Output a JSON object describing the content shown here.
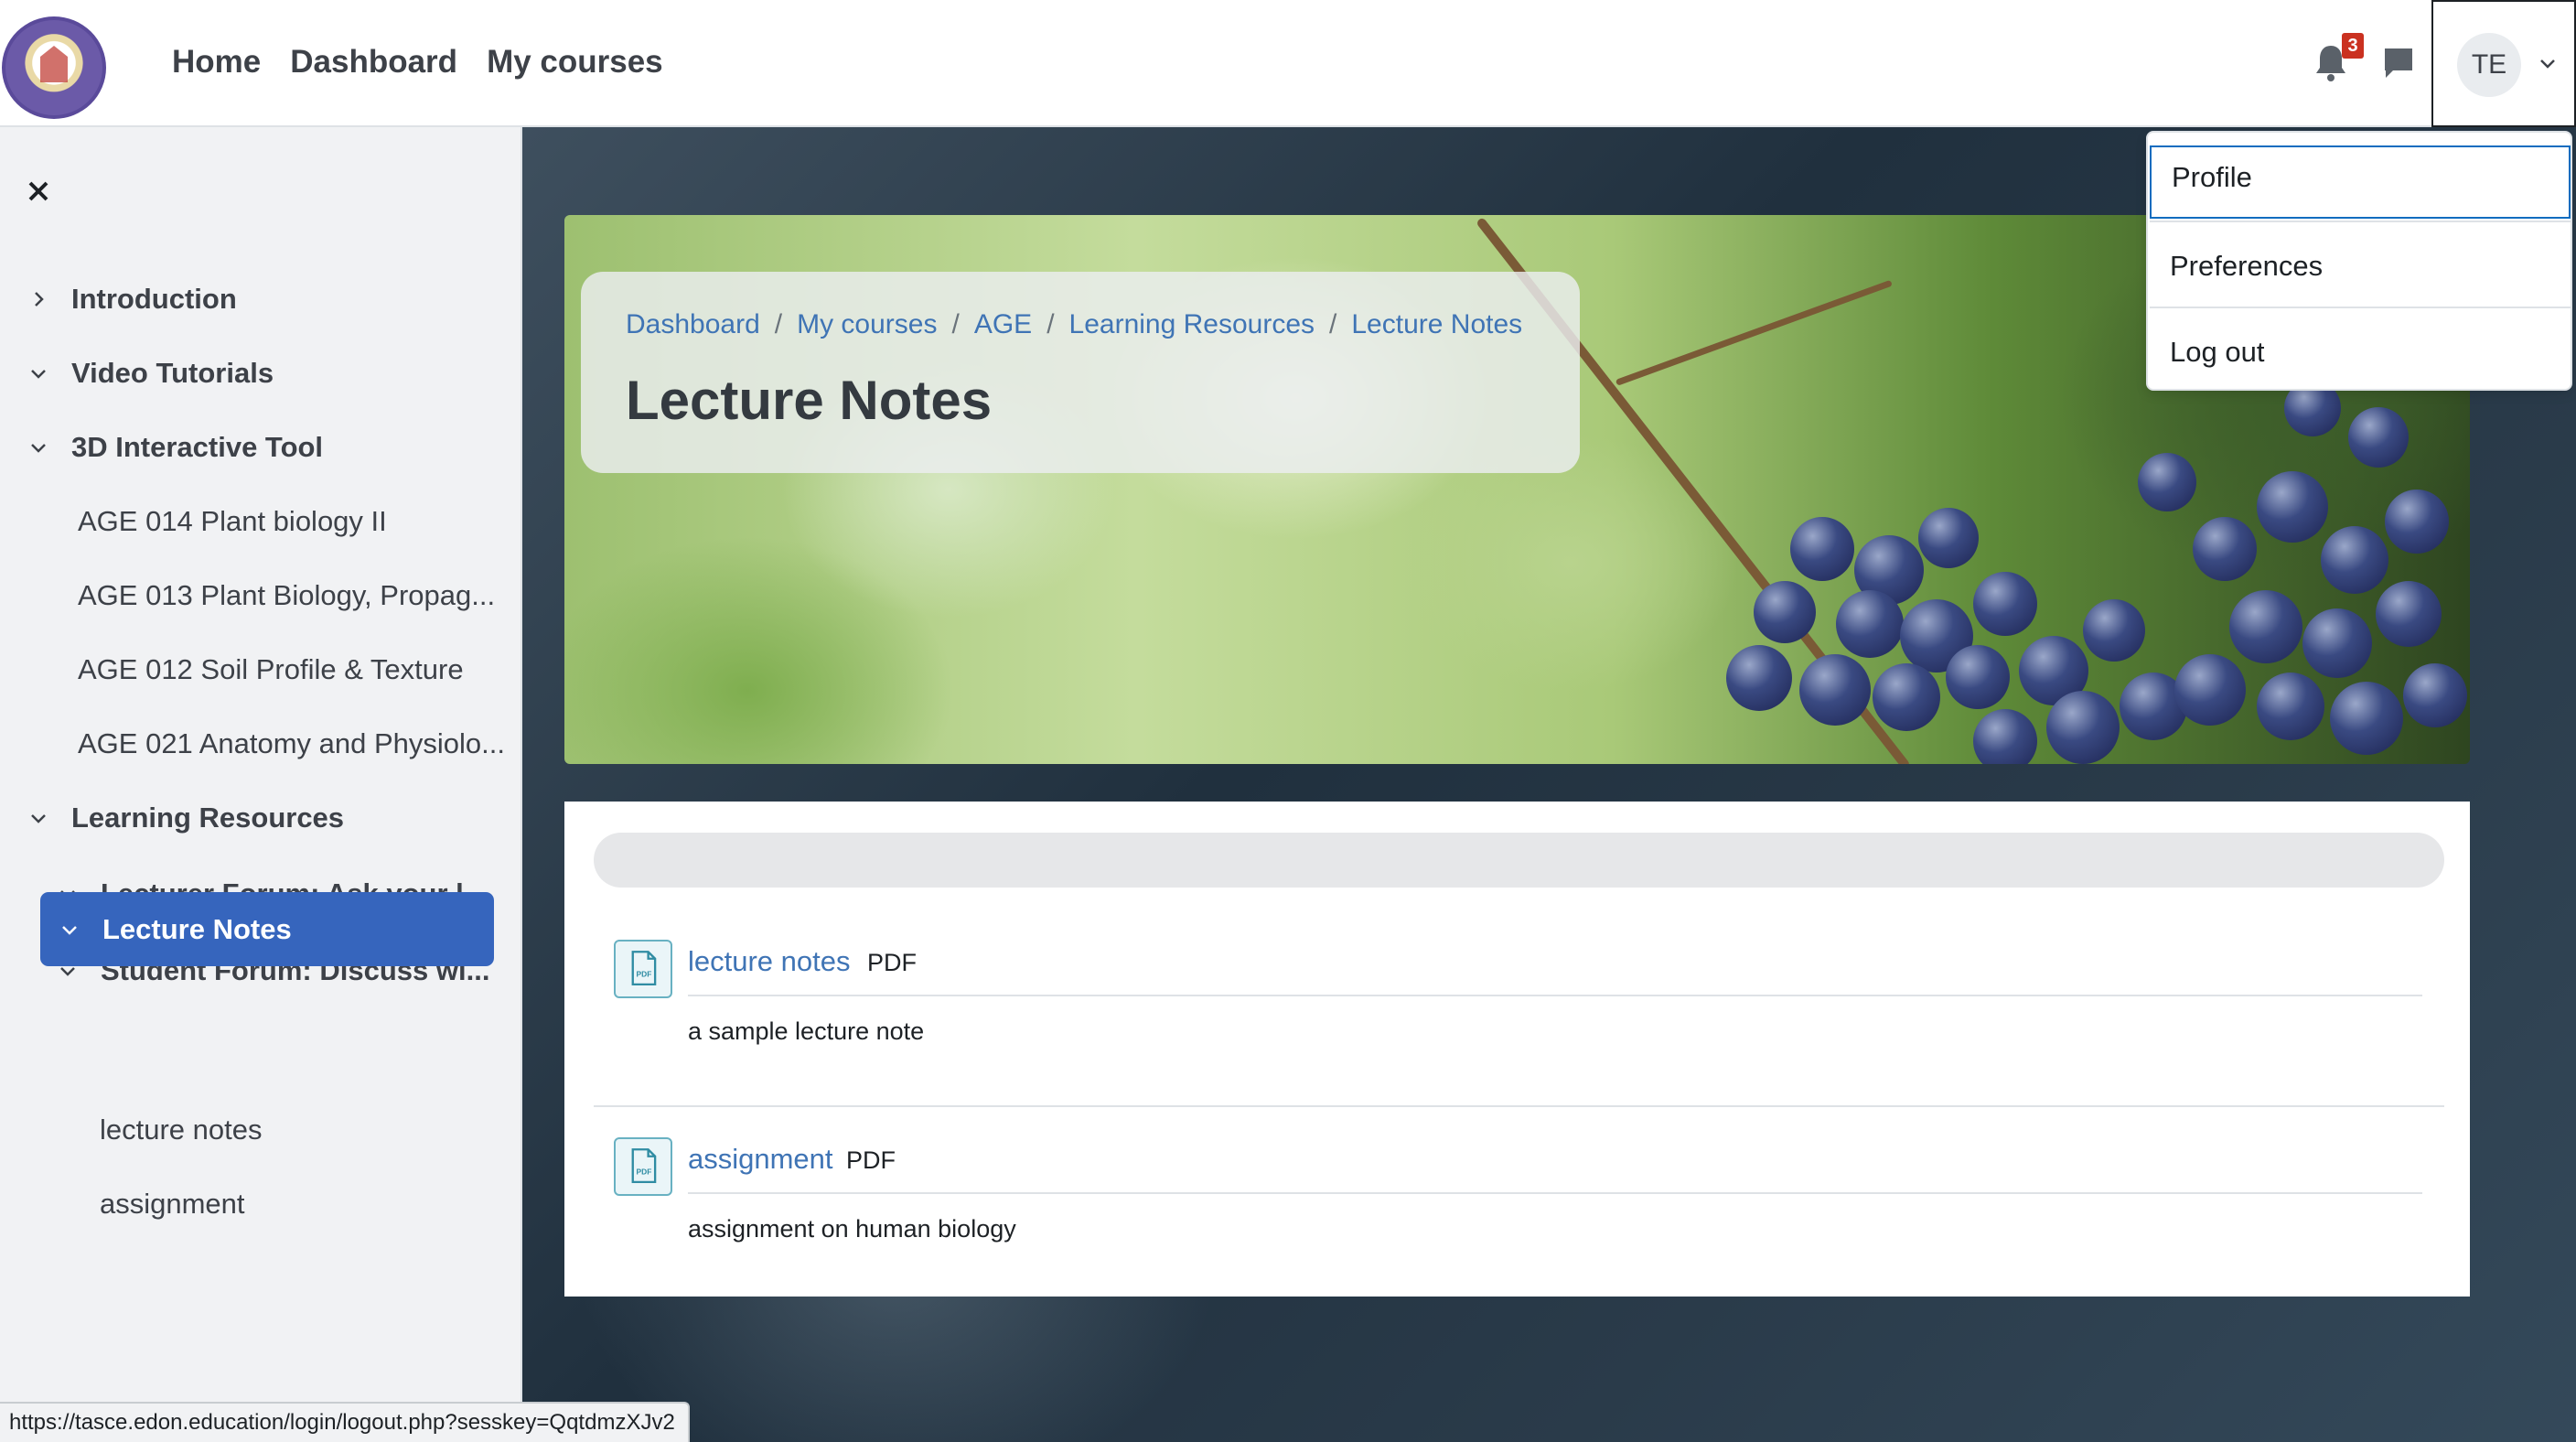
{
  "navbar": {
    "links": [
      "Home",
      "Dashboard",
      "My courses"
    ],
    "notification_count": "3",
    "user_initials": "TE"
  },
  "user_dropdown": {
    "items": [
      "Profile",
      "Preferences",
      "Log out"
    ]
  },
  "sidebar": {
    "items": [
      {
        "label": "Introduction"
      },
      {
        "label": "Video Tutorials"
      },
      {
        "label": "3D Interactive Tool"
      },
      {
        "label": "AGE 014 Plant biology II"
      },
      {
        "label": "AGE 013 Plant Biology, Propag..."
      },
      {
        "label": "AGE 012 Soil Profile & Texture"
      },
      {
        "label": "AGE 021 Anatomy and Physiolo..."
      },
      {
        "label": "Learning Resources"
      },
      {
        "label": "Lecturer Forum: Ask your l..."
      },
      {
        "label": "Student Forum: Discuss wi..."
      },
      {
        "label": "Lecture Notes"
      },
      {
        "label": "lecture notes"
      },
      {
        "label": "assignment"
      }
    ]
  },
  "breadcrumb": [
    "Dashboard",
    "My courses",
    "AGE",
    "Learning Resources",
    "Lecture Notes"
  ],
  "page_title": "Lecture Notes",
  "activities": [
    {
      "name": "lecture notes",
      "type": "PDF",
      "description": "a sample lecture note",
      "icon_label": "PDF"
    },
    {
      "name": "assignment",
      "type": "PDF",
      "description": "assignment on human biology",
      "icon_label": "PDF"
    }
  ],
  "status_url": "https://tasce.edon.education/login/logout.php?sesskey=QqtdmzXJv2",
  "colors": {
    "accent": "#3665bd",
    "link": "#3f74b5",
    "badge": "#ca3120"
  }
}
